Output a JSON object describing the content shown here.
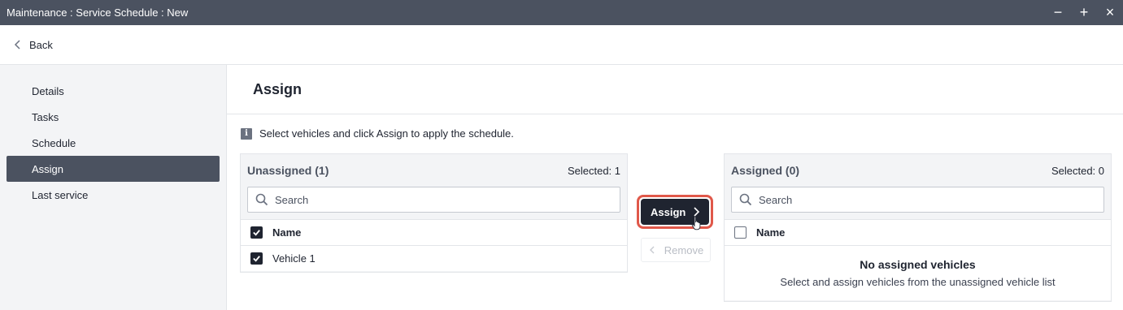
{
  "window": {
    "title": "Maintenance : Service Schedule : New",
    "minimize": "−",
    "maximize": "+",
    "close": "×"
  },
  "topbar": {
    "back_label": "Back"
  },
  "sidebar": {
    "items": [
      {
        "label": "Details"
      },
      {
        "label": "Tasks"
      },
      {
        "label": "Schedule"
      },
      {
        "label": "Assign",
        "active": true
      },
      {
        "label": "Last service"
      }
    ]
  },
  "main": {
    "title": "Assign",
    "info_text": "Select vehicles and click Assign to apply the schedule."
  },
  "unassigned": {
    "title": "Unassigned (1)",
    "selected": "Selected: 1",
    "search_placeholder": "Search",
    "column_name": "Name",
    "header_checked": true,
    "rows": [
      {
        "name": "Vehicle 1",
        "checked": true
      }
    ]
  },
  "actions": {
    "assign_label": "Assign",
    "remove_label": "Remove"
  },
  "assigned": {
    "title": "Assigned (0)",
    "selected": "Selected: 0",
    "search_placeholder": "Search",
    "column_name": "Name",
    "header_checked": false,
    "empty_title": "No assigned vehicles",
    "empty_text": "Select and assign vehicles from the unassigned vehicle list"
  },
  "colors": {
    "titlebar": "#4b5260",
    "active_nav": "#4b5260",
    "primary_button": "#1f2430",
    "highlight": "#e0584a"
  }
}
